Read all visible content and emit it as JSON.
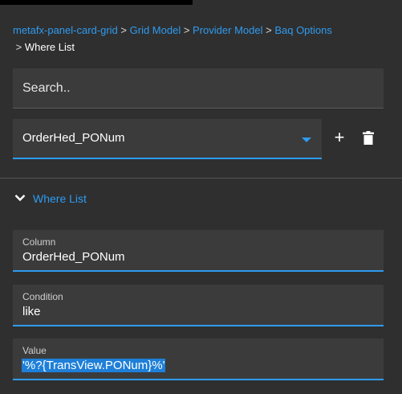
{
  "breadcrumb": {
    "items": [
      "metafx-panel-card-grid",
      "Grid Model",
      "Provider Model",
      "Baq Options"
    ],
    "separator": ">",
    "current": "Where List"
  },
  "search": {
    "placeholder": "Search..",
    "value": ""
  },
  "selector": {
    "value": "OrderHed_PONum"
  },
  "toolbar": {
    "add_label": "+"
  },
  "section": {
    "title": "Where List"
  },
  "fields": {
    "column": {
      "label": "Column",
      "value": "OrderHed_PONum"
    },
    "condition": {
      "label": "Condition",
      "value": "like"
    },
    "value": {
      "label": "Value",
      "value": "'%?{TransView.PONum}%'"
    }
  },
  "colors": {
    "accent": "#2e9bf0",
    "background": "#2f2f2f",
    "field_background": "#3b3b3b",
    "selection": "#1e7fd8"
  },
  "icons": {
    "dropdown": "caret-down-icon",
    "add": "plus-icon",
    "delete": "trash-icon",
    "collapse": "chevron-down-icon"
  }
}
